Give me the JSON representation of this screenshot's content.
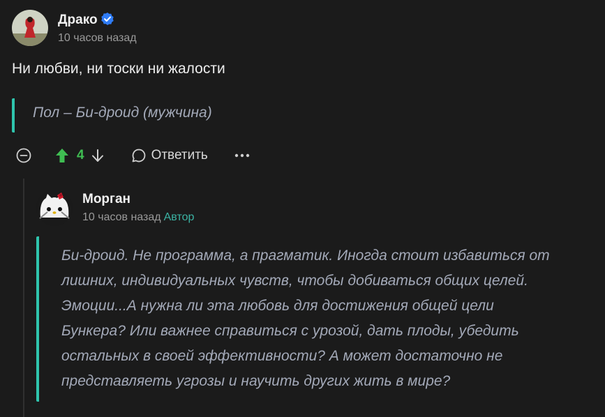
{
  "parent": {
    "author": "Драко",
    "time": "10 часов назад",
    "text": "Ни любви, ни тоски ни жалости",
    "quote": "Пол – Би-дроид (мужчина)",
    "rating": "4",
    "reply_label": "Ответить"
  },
  "reply": {
    "author": "Морган",
    "time": "10 часов назад",
    "badge": "Автор",
    "quote_lines": [
      "Би-дроид. Не программа, а прагматик. Иногда стоит избавиться от",
      "лишних, индивидуальных чувств, чтобы добиваться общих целей.",
      "Эмоции...А нужна ли эта любовь для достижения общей цели",
      "Бункера? Или важнее справиться с урозой, дать плоды, убедить",
      "остальных в своей эффективности? А может достаточно не",
      "представляеть угрозы и научить других жить в мире?"
    ]
  },
  "colors": {
    "background": "#1b1b1b",
    "accent_teal": "#2fc4ad",
    "upvote_green": "#3fbd52",
    "verified_blue": "#2f7cf6"
  },
  "icons": [
    "collapse-icon",
    "upvote-icon",
    "downvote-icon",
    "reply-icon",
    "more-icon",
    "verified-icon"
  ]
}
